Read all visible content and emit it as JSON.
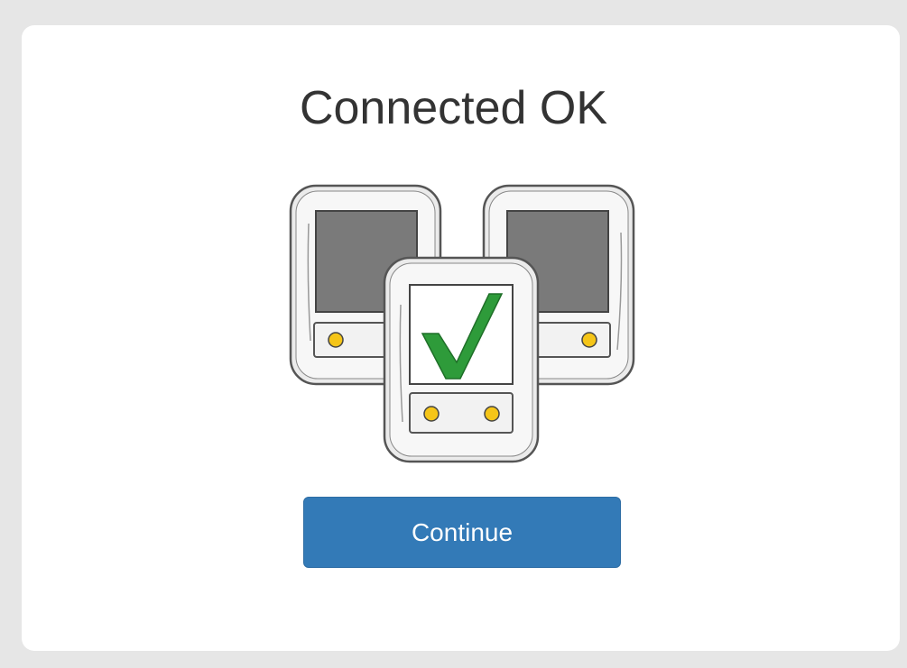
{
  "status": {
    "title": "Connected OK"
  },
  "actions": {
    "continue_label": "Continue"
  },
  "illustration": {
    "icon": "connected-devices-checkmark",
    "check_color": "#2e9b3a",
    "screen_color": "#7a7a7a",
    "button_dot_color": "#f5c518"
  },
  "colors": {
    "page_background": "#e6e6e6",
    "card_background": "#ffffff",
    "primary_button": "#337ab7",
    "title_text": "#333333"
  }
}
